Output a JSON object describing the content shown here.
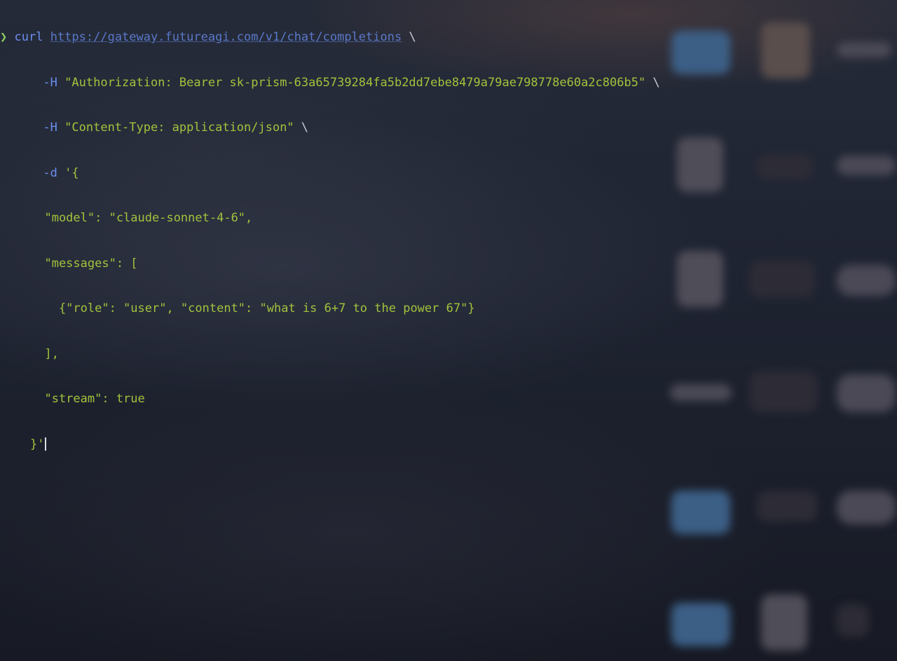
{
  "terminal": {
    "prompt_symbol": "❯",
    "command": "curl",
    "url": "https://gateway.futureagi.com/v1/chat/completions",
    "continuation": "\\",
    "header_flag": "-H",
    "auth_header": "\"Authorization: Bearer sk-prism-63a65739284fa5b2dd7ebe8479a79ae798778e60a2c806b5\"",
    "content_type_header": "\"Content-Type: application/json\"",
    "data_flag": "-d",
    "data_open": "'{",
    "body_lines": [
      "  \"model\": \"claude-sonnet-4-6\",",
      "  \"messages\": [",
      "    {\"role\": \"user\", \"content\": \"what is 6+7 to the power 67\"}",
      "  ],",
      "  \"stream\": true",
      "}'"
    ]
  },
  "colors": {
    "background": "#1d2230",
    "prompt": "#8bd060",
    "command": "#6c8ef0",
    "string": "#a3c23c",
    "cursor": "#d8dbe3"
  }
}
